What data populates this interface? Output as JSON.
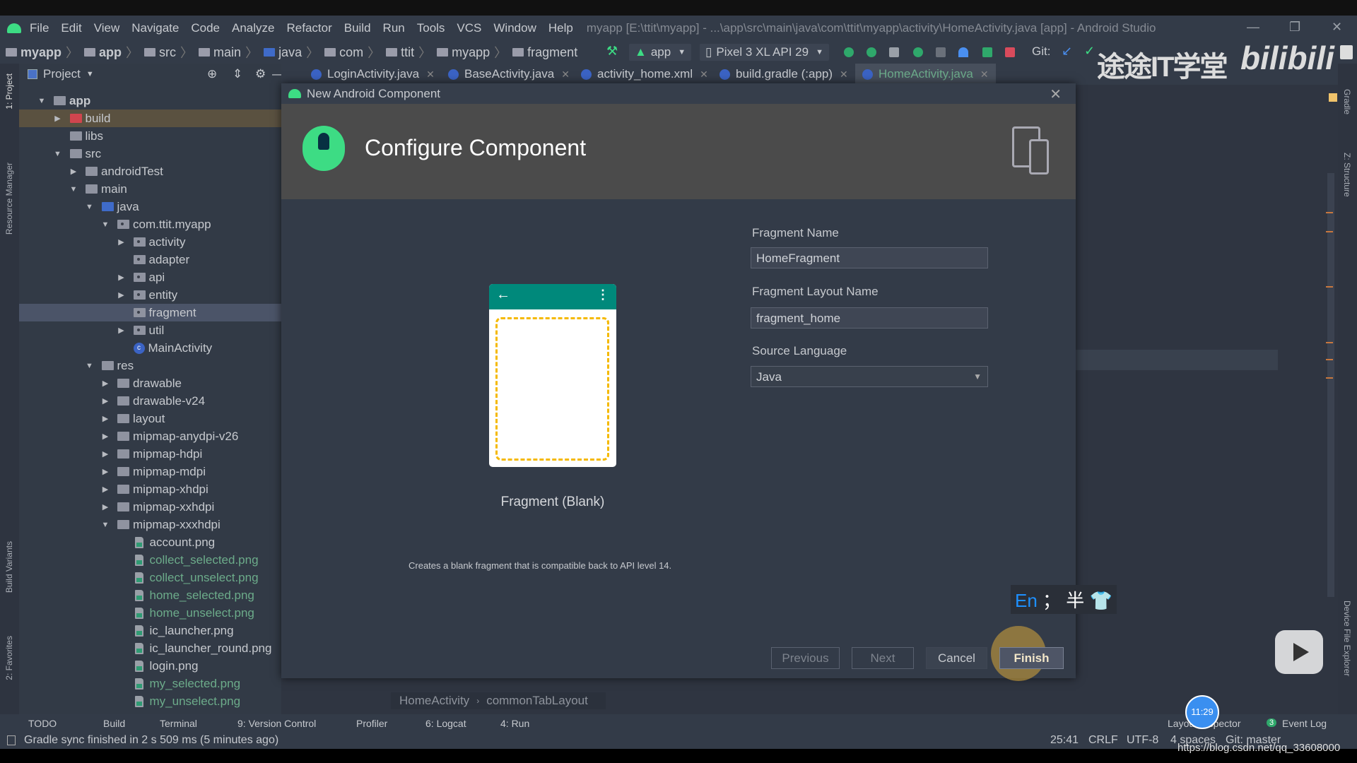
{
  "menu": {
    "items": [
      "File",
      "Edit",
      "View",
      "Navigate",
      "Code",
      "Analyze",
      "Refactor",
      "Build",
      "Run",
      "Tools",
      "VCS",
      "Window",
      "Help"
    ],
    "window_title": "myapp [E:\\ttit\\myapp] - ...\\app\\src\\main\\java\\com\\ttit\\myapp\\activity\\HomeActivity.java [app] - Android Studio",
    "minimize": "—",
    "restore": "❐",
    "close": "✕"
  },
  "breadcrumb": [
    "myapp",
    "app",
    "src",
    "main",
    "java",
    "com",
    "ttit",
    "myapp",
    "fragment"
  ],
  "toolbar": {
    "run_config": "app",
    "device": "Pixel 3 XL API 29",
    "git_label": "Git:"
  },
  "left_strip": {
    "project": "1: Project",
    "resource_manager": "Resource Manager",
    "build_variants": "Build Variants",
    "favorites": "2: Favorites"
  },
  "right_strip": {
    "gradle": "Gradle",
    "structure": "Z: Structure",
    "device_file_explorer": "Device File Explorer"
  },
  "project_panel": {
    "title": "Project",
    "tree": [
      {
        "label": "app",
        "level": 0,
        "arrow": "open",
        "icon": "module",
        "bold": true
      },
      {
        "label": "build",
        "level": 1,
        "arrow": "closed",
        "icon": "folder-red",
        "state": "highlight"
      },
      {
        "label": "libs",
        "level": 1,
        "arrow": "none",
        "icon": "folder"
      },
      {
        "label": "src",
        "level": 1,
        "arrow": "open",
        "icon": "folder"
      },
      {
        "label": "androidTest",
        "level": 2,
        "arrow": "closed",
        "icon": "folder"
      },
      {
        "label": "main",
        "level": 2,
        "arrow": "open",
        "icon": "folder"
      },
      {
        "label": "java",
        "level": 3,
        "arrow": "open",
        "icon": "folder-blue"
      },
      {
        "label": "com.ttit.myapp",
        "level": 4,
        "arrow": "open",
        "icon": "package"
      },
      {
        "label": "activity",
        "level": 5,
        "arrow": "closed",
        "icon": "package"
      },
      {
        "label": "adapter",
        "level": 5,
        "arrow": "none",
        "icon": "package"
      },
      {
        "label": "api",
        "level": 5,
        "arrow": "closed",
        "icon": "package"
      },
      {
        "label": "entity",
        "level": 5,
        "arrow": "closed",
        "icon": "package"
      },
      {
        "label": "fragment",
        "level": 5,
        "arrow": "none",
        "icon": "package",
        "state": "selected"
      },
      {
        "label": "util",
        "level": 5,
        "arrow": "closed",
        "icon": "package"
      },
      {
        "label": "MainActivity",
        "level": 5,
        "arrow": "none",
        "icon": "class"
      },
      {
        "label": "res",
        "level": 3,
        "arrow": "open",
        "icon": "folder-res"
      },
      {
        "label": "drawable",
        "level": 4,
        "arrow": "closed",
        "icon": "folder"
      },
      {
        "label": "drawable-v24",
        "level": 4,
        "arrow": "closed",
        "icon": "folder"
      },
      {
        "label": "layout",
        "level": 4,
        "arrow": "closed",
        "icon": "folder"
      },
      {
        "label": "mipmap-anydpi-v26",
        "level": 4,
        "arrow": "closed",
        "icon": "folder"
      },
      {
        "label": "mipmap-hdpi",
        "level": 4,
        "arrow": "closed",
        "icon": "folder"
      },
      {
        "label": "mipmap-mdpi",
        "level": 4,
        "arrow": "closed",
        "icon": "folder"
      },
      {
        "label": "mipmap-xhdpi",
        "level": 4,
        "arrow": "closed",
        "icon": "folder"
      },
      {
        "label": "mipmap-xxhdpi",
        "level": 4,
        "arrow": "closed",
        "icon": "folder"
      },
      {
        "label": "mipmap-xxxhdpi",
        "level": 4,
        "arrow": "open",
        "icon": "folder"
      },
      {
        "label": "account.png",
        "level": 5,
        "arrow": "none",
        "icon": "image"
      },
      {
        "label": "collect_selected.png",
        "level": 5,
        "arrow": "none",
        "icon": "image",
        "vcs": "added"
      },
      {
        "label": "collect_unselect.png",
        "level": 5,
        "arrow": "none",
        "icon": "image",
        "vcs": "added"
      },
      {
        "label": "home_selected.png",
        "level": 5,
        "arrow": "none",
        "icon": "image",
        "vcs": "added"
      },
      {
        "label": "home_unselect.png",
        "level": 5,
        "arrow": "none",
        "icon": "image",
        "vcs": "added"
      },
      {
        "label": "ic_launcher.png",
        "level": 5,
        "arrow": "none",
        "icon": "image"
      },
      {
        "label": "ic_launcher_round.png",
        "level": 5,
        "arrow": "none",
        "icon": "image"
      },
      {
        "label": "login.png",
        "level": 5,
        "arrow": "none",
        "icon": "image"
      },
      {
        "label": "my_selected.png",
        "level": 5,
        "arrow": "none",
        "icon": "image",
        "vcs": "added"
      },
      {
        "label": "my_unselect.png",
        "level": 5,
        "arrow": "none",
        "icon": "image",
        "vcs": "added"
      }
    ]
  },
  "editor_tabs": [
    {
      "label": "LoginActivity.java"
    },
    {
      "label": "BaseActivity.java"
    },
    {
      "label": "activity_home.xml"
    },
    {
      "label": "build.gradle (:app)"
    },
    {
      "label": "HomeActivity.java",
      "active": true
    }
  ],
  "dialog": {
    "title": "New Android Component",
    "close": "✕",
    "heading": "Configure Component",
    "template_name": "Fragment (Blank)",
    "description": "Creates a blank fragment that is compatible back to API level 14.",
    "fields": {
      "fragment_name": {
        "label": "Fragment Name",
        "value": "HomeFragment"
      },
      "layout_name": {
        "label": "Fragment Layout Name",
        "value": "fragment_home"
      },
      "source_language": {
        "label": "Source Language",
        "value": "Java"
      }
    },
    "buttons": {
      "previous": "Previous",
      "next": "Next",
      "cancel": "Cancel",
      "finish": "Finish"
    }
  },
  "editor_breadcrumb": [
    "HomeActivity",
    "commonTabLayout"
  ],
  "tool_windows": {
    "left": [
      "TODO",
      "Build",
      "Terminal",
      "9: Version Control",
      "Profiler",
      "6: Logcat",
      "4: Run"
    ],
    "right": [
      "Layout Inspector",
      "Event Log"
    ],
    "event_count": "3"
  },
  "status": {
    "message": "Gradle sync finished in 2 s 509 ms (5 minutes ago)",
    "position": "25:41",
    "line_sep": "CRLF",
    "encoding": "UTF-8",
    "indent": "4 spaces",
    "git": "Git: master"
  },
  "overlay": {
    "watermark": "途途IT学堂",
    "bilibili": "bilibili",
    "ime": [
      "En",
      "；",
      "半"
    ],
    "clock": "11:29",
    "url": "https://blog.csdn.net/qq_33608000"
  },
  "colors": {
    "accent_green": "#3ddc84",
    "teal": "#00897b",
    "vcs_added": "#6cab8a",
    "dash": "#f5b900"
  }
}
